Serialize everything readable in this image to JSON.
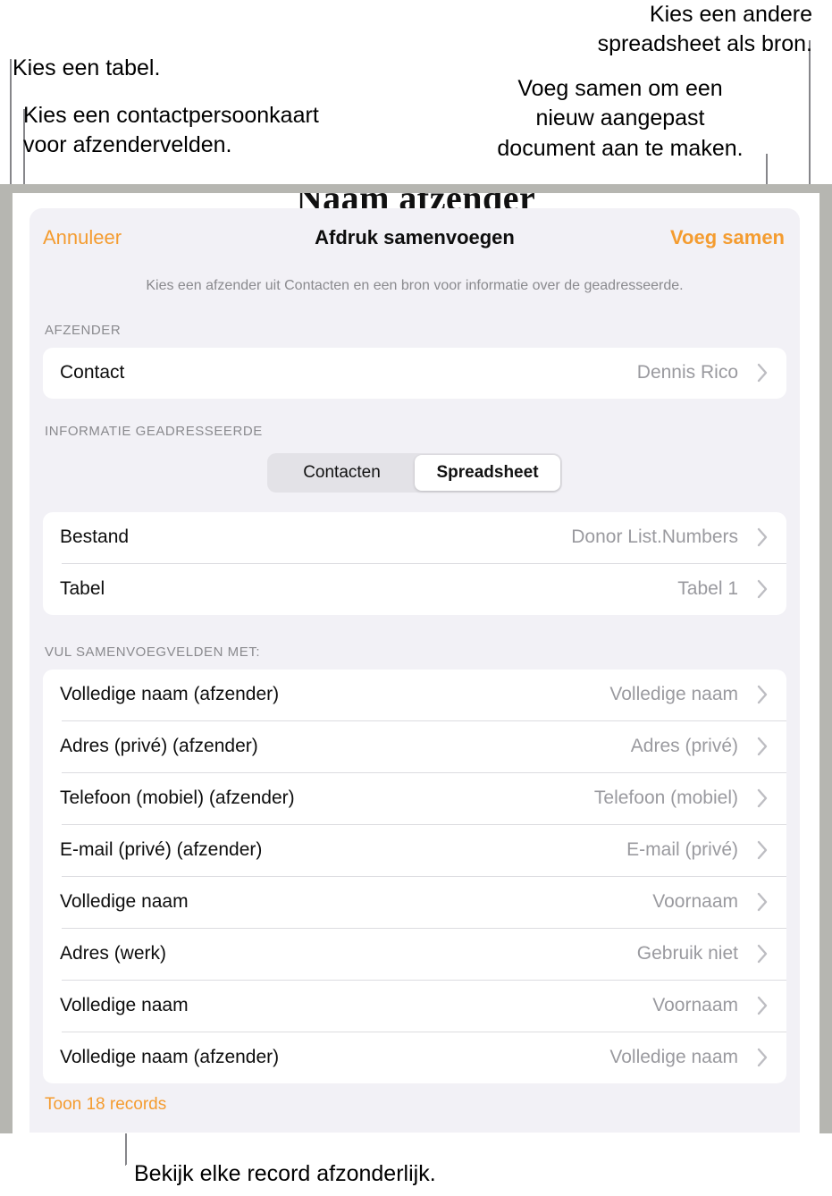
{
  "callouts": {
    "choose_table": "Kies een tabel.",
    "choose_contact_card": "Kies een contactpersoonkaart\nvoor afzendervelden.",
    "choose_other_spreadsheet": "Kies een andere\nspreadsheet als bron.",
    "merge_to_create": "Voeg samen om een\nnieuw aangepast\ndocument aan te maken.",
    "view_each_record": "Bekijk elke record afzonderlijk."
  },
  "document": {
    "heading": "Naam afzender"
  },
  "sheet": {
    "cancel_label": "Annuleer",
    "title": "Afdruk samenvoegen",
    "merge_label": "Voeg samen",
    "subtitle": "Kies een afzender uit Contacten en een bron voor informatie over de geadresseerde.",
    "sender_section_label": "AFZENDER",
    "sender_row": {
      "label": "Contact",
      "value": "Dennis Rico"
    },
    "recipient_section_label": "INFORMATIE GEADRESSEERDE",
    "segmented": {
      "options": [
        "Contacten",
        "Spreadsheet"
      ],
      "selected": "Spreadsheet"
    },
    "source_rows": [
      {
        "label": "Bestand",
        "value": "Donor List.Numbers"
      },
      {
        "label": "Tabel",
        "value": "Tabel 1"
      }
    ],
    "merge_fields_label": "VUL SAMENVOEGVELDEN MET:",
    "merge_fields": [
      {
        "label": "Volledige naam (afzender)",
        "value": "Volledige naam"
      },
      {
        "label": "Adres (privé) (afzender)",
        "value": "Adres (privé)"
      },
      {
        "label": "Telefoon (mobiel) (afzender)",
        "value": "Telefoon (mobiel)"
      },
      {
        "label": "E-mail (privé) (afzender)",
        "value": "E-mail (privé)"
      },
      {
        "label": "Volledige naam",
        "value": "Voornaam"
      },
      {
        "label": "Adres (werk)",
        "value": "Gebruik niet"
      },
      {
        "label": "Volledige naam",
        "value": "Voornaam"
      },
      {
        "label": "Volledige naam (afzender)",
        "value": "Volledige naam"
      }
    ],
    "show_records_label": "Toon 18 records"
  },
  "colors": {
    "accent_orange": "#f49c30",
    "sheet_background": "#f2f1f6",
    "card_background": "#ffffff",
    "secondary_text": "#8a8a8e",
    "leader_line": "#86868a",
    "document_band": "#b6b6b1"
  }
}
